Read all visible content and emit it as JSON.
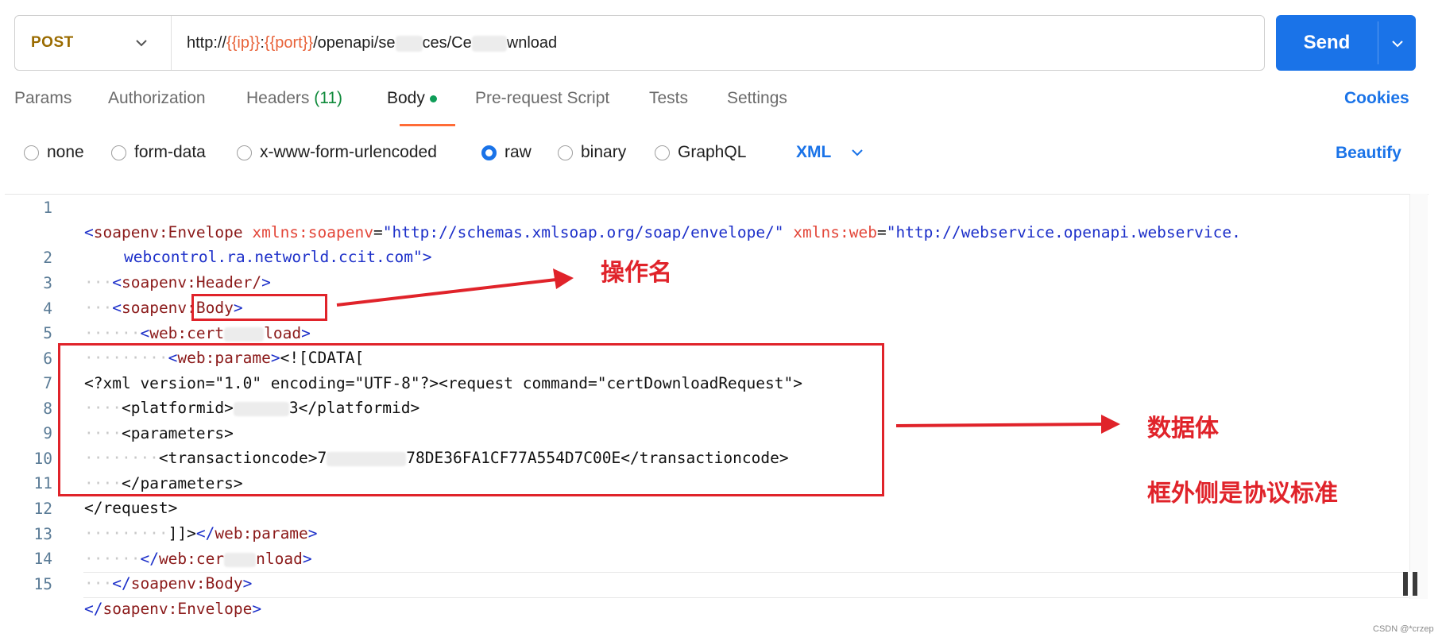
{
  "request": {
    "method": "POST",
    "url": {
      "prefix": "http://",
      "ip_var": "{{ip}}",
      "colon": ":",
      "port_var": "{{port}}",
      "path_a": "/openapi/se",
      "path_b": "ces/Ce",
      "path_c": "wnload"
    },
    "send_label": "Send"
  },
  "tabs": {
    "params": "Params",
    "authorization": "Authorization",
    "headers": "Headers",
    "headers_count": "(11)",
    "body": "Body",
    "pre_request": "Pre-request Script",
    "tests": "Tests",
    "settings": "Settings",
    "cookies": "Cookies",
    "active": "Body"
  },
  "body_types": {
    "none": "none",
    "form_data": "form-data",
    "urlencoded": "x-www-form-urlencoded",
    "raw": "raw",
    "binary": "binary",
    "graphql": "GraphQL",
    "selected": "raw",
    "language": "XML",
    "beautify": "Beautify"
  },
  "editor": {
    "line_numbers": [
      "1",
      "2",
      "3",
      "4",
      "5",
      "6",
      "7",
      "8",
      "9",
      "10",
      "11",
      "12",
      "13",
      "14",
      "15"
    ],
    "l1": {
      "tag": "soapenv:Envelope",
      "attr1": "xmlns:soapenv",
      "val1": "\"http://schemas.xmlsoap.org/soap/envelope/\"",
      "attr2": "xmlns:web",
      "val2a": "\"http://webservice.openapi.webservice.",
      "val2b": "webcontrol.ra.networld.ccit.com\""
    },
    "l2": "soapenv:Header/",
    "l3": "soapenv:Body",
    "l4_prefix": "web:",
    "l4_a": "cert",
    "l4_b": "load",
    "l5_tag": "web:parame",
    "l5_cdata": "<![CDATA[",
    "l6": "<?xml version=\"1.0\" encoding=\"UTF-8\"?><request command=\"certDownloadRequest\">",
    "l7_open": "<platformid>",
    "l7_val": "3",
    "l7_close": "</platformid>",
    "l8": "<parameters>",
    "l9_open": "<transactioncode>7",
    "l9_val": "78DE36FA1CF77A554D7C00E",
    "l9_close": "</transactioncode>",
    "l10": "</parameters>",
    "l11": "</request>",
    "l12_cdata": "]]>",
    "l12_tag": "web:parame",
    "l13_a": "web:cer",
    "l13_b": "nload",
    "l14": "soapenv:Body",
    "l15": "soapenv:Envelope"
  },
  "annotations": {
    "operation_name": "操作名",
    "data_body": "数据体",
    "outside_protocol": "框外侧是协议标准",
    "color": "#e0232a"
  },
  "watermark": "CSDN @*crzep",
  "colors": {
    "accent": "#1a73e8",
    "method": "#9a6b00",
    "url_variable": "#e8633a",
    "tab_indicator": "#ff6c37",
    "status_dot": "#0f9d58"
  }
}
